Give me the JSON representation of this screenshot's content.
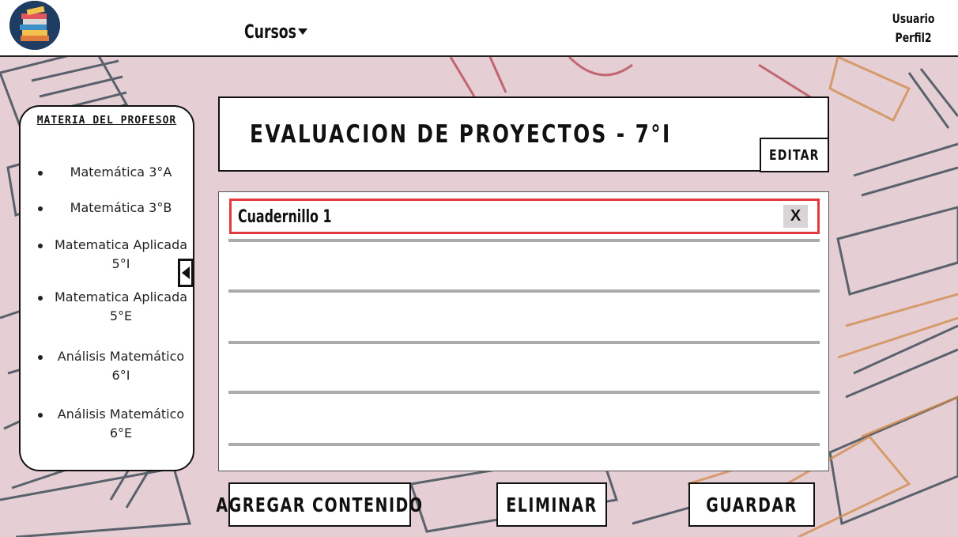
{
  "header": {
    "logo": "books-logo",
    "courses_menu_label": "Cursos",
    "courses_menu_icon": "caret-down-icon",
    "user_line1": "Usuario",
    "user_line2": "Perfil2"
  },
  "sidebar": {
    "title": "MATERIA DEL PROFESOR",
    "items": [
      {
        "label": "Matemática 3°A"
      },
      {
        "label": "Matemática 3°B"
      },
      {
        "label": "Matematica Aplicada 5°I"
      },
      {
        "label": "Matematica Aplicada 5°E"
      },
      {
        "label": "Análisis Matemático 6°I"
      },
      {
        "label": "Análisis Matemático 6°E"
      }
    ],
    "collapse_icon": "triangle-left-icon"
  },
  "main": {
    "title": "EVALUACION DE PROYECTOS - 7°I",
    "edit_label": "EDITAR",
    "chapter": {
      "value": "Cuadernillo 1",
      "close_label": "X"
    },
    "content_lines": 5
  },
  "actions": {
    "add_label": "AGREGAR CONTENIDO",
    "delete_label": "ELIMINAR",
    "save_label": "GUARDAR"
  },
  "colors": {
    "background": "#e5cfd4",
    "highlight_border": "#e2383f",
    "logo_bg": "#1f3c63",
    "line_gray": "#ababab"
  }
}
